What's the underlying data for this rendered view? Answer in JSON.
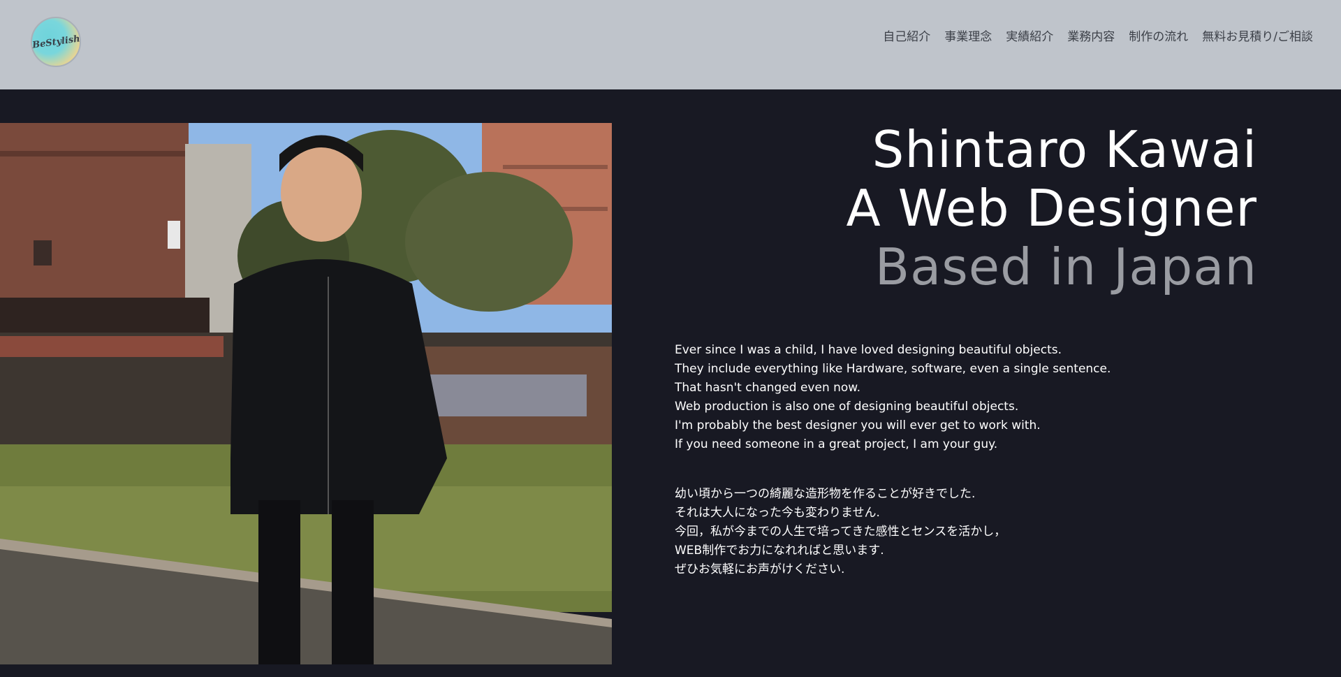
{
  "header": {
    "logo_text": "BeStylish",
    "nav": [
      {
        "label": "自己紹介"
      },
      {
        "label": "事業理念"
      },
      {
        "label": "実績紹介"
      },
      {
        "label": "業務内容"
      },
      {
        "label": "制作の流れ"
      },
      {
        "label": "無料お見積り/ご相談"
      }
    ]
  },
  "hero": {
    "line1": "Shintaro Kawai",
    "line2": "A Web Designer",
    "line3": "Based in Japan"
  },
  "bio_en": [
    "Ever since I was a child, I have loved designing beautiful objects.",
    "They include everything like Hardware, software, even a single sentence.",
    "That hasn't changed even now.",
    "Web production is also one of designing beautiful objects.",
    "I'm probably the best designer you will ever get to work with.",
    "If you need someone in a great project, I am your guy."
  ],
  "bio_jp": [
    "幼い頃から一つの綺麗な造形物を作ることが好きでした.",
    "それは大人になった今も変わりません.",
    "今回，私が今までの人生で培ってきた感性とセンスを活かし，",
    "WEB制作でお力になれればと思います.",
    "ぜひお気軽にお声がけください."
  ],
  "colors": {
    "header_bg": "#bfc4cb",
    "page_bg": "#181923",
    "accent_gray": "#9a9ca2"
  }
}
